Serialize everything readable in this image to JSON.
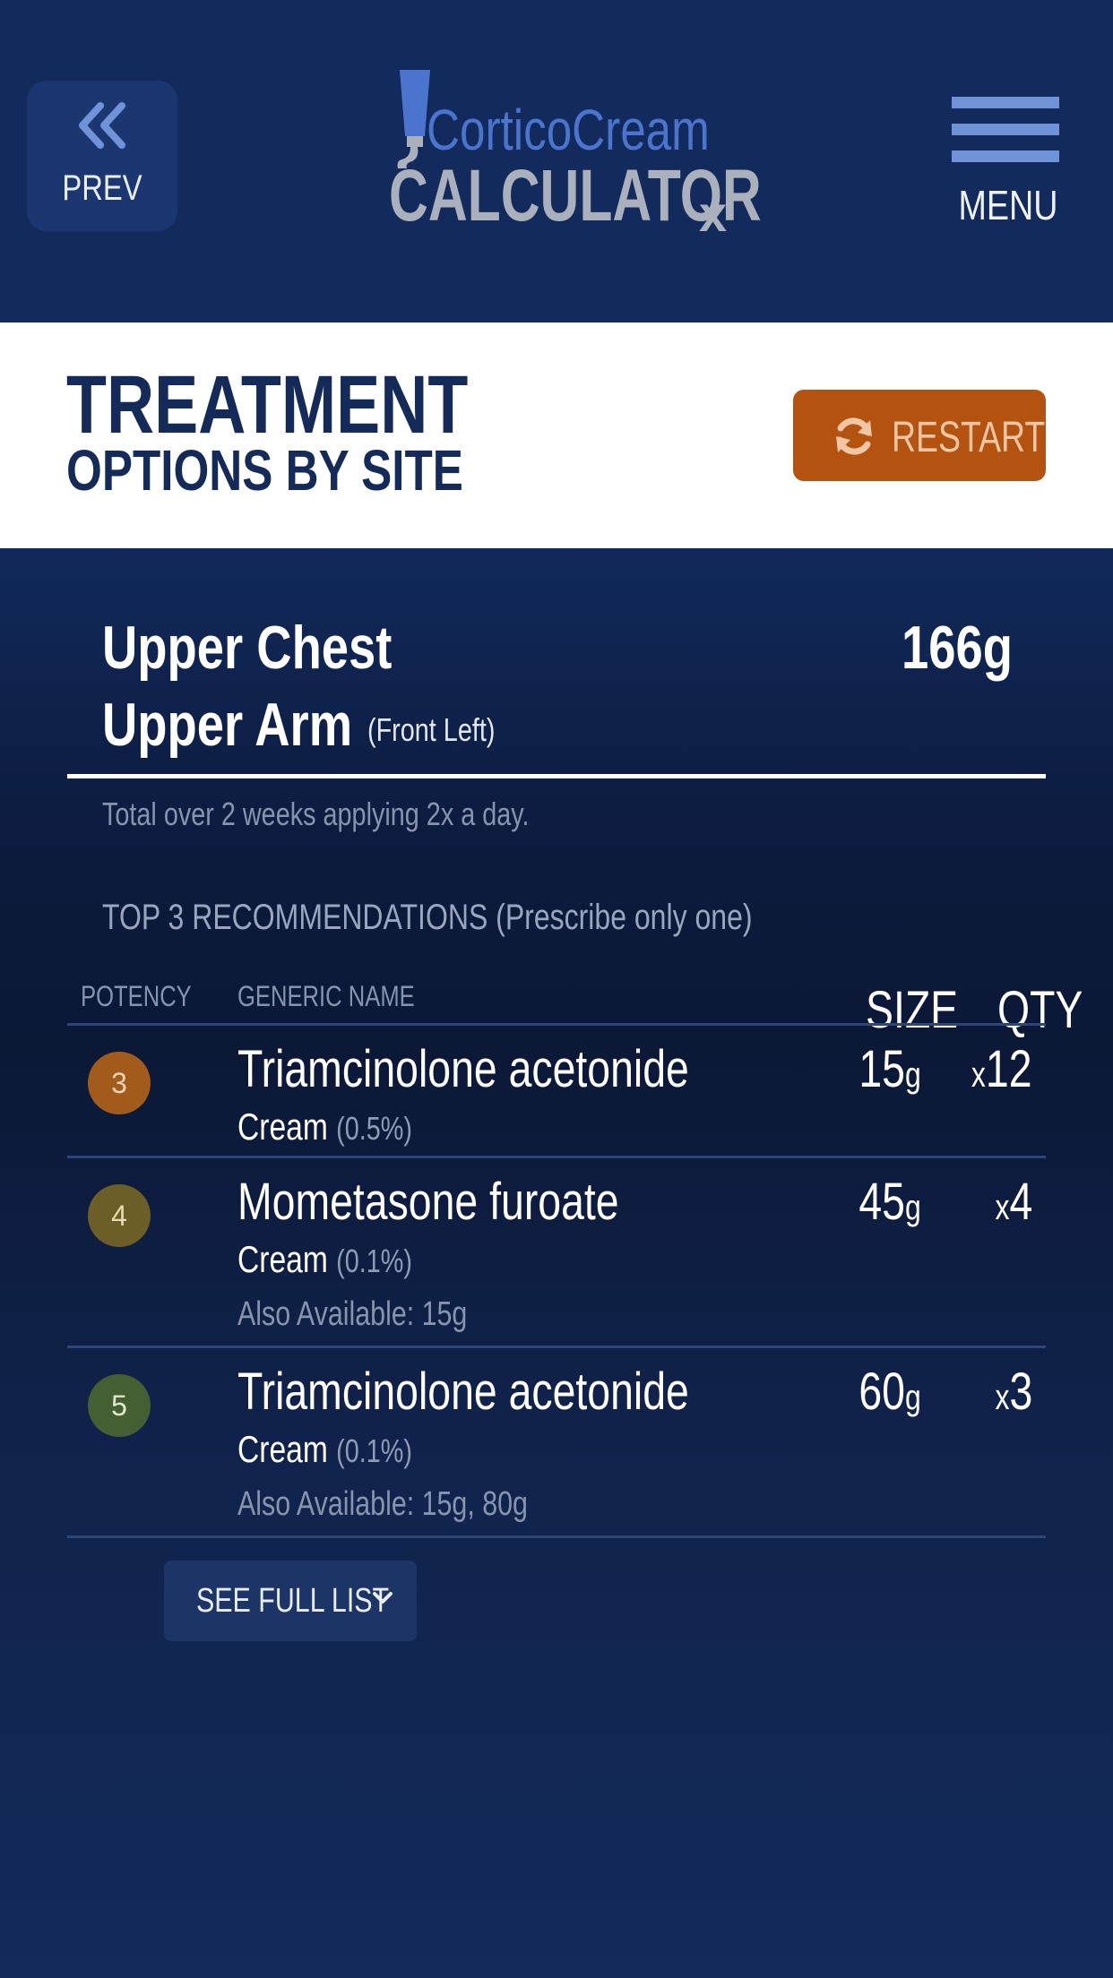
{
  "header": {
    "prev_label": "PREV",
    "logo_line1": "CorticoCream",
    "logo_line2": "CALCULATOR",
    "logo_rx": "x",
    "menu_label": "MENU"
  },
  "title": {
    "main": "TREATMENT",
    "sub": "OPTIONS BY SITE",
    "restart_label": "RESTART"
  },
  "summary": {
    "site_line1": "Upper Chest",
    "site_line2": "Upper Arm",
    "site_detail": "(Front Left)",
    "total_grams": "166g",
    "note": "Total over 2 weeks applying 2x a day."
  },
  "recommendations": {
    "title": "TOP 3 RECOMMENDATIONS (Prescribe only one)",
    "columns": {
      "potency": "POTENCY",
      "generic": "GENERIC NAME",
      "size": "SIZE",
      "qty": "QTY"
    },
    "rows": [
      {
        "potency": "3",
        "potency_color": "#a35b1c",
        "potency_text_color": "#f0d2b4",
        "name": "Triamcinolone acetonide",
        "form": "Cream",
        "concentration": "(0.5%)",
        "size": "15",
        "size_unit": "g",
        "qty_prefix": "x",
        "qty": "12",
        "also": ""
      },
      {
        "potency": "4",
        "potency_color": "#6b5e26",
        "potency_text_color": "#e5dcae",
        "name": "Mometasone furoate",
        "form": "Cream",
        "concentration": "(0.1%)",
        "size": "45",
        "size_unit": "g",
        "qty_prefix": "x",
        "qty": "4",
        "also": "Also Available: 15g"
      },
      {
        "potency": "5",
        "potency_color": "#445f31",
        "potency_text_color": "#dde8cc",
        "name": "Triamcinolone acetonide",
        "form": "Cream",
        "concentration": "(0.1%)",
        "size": "60",
        "size_unit": "g",
        "qty_prefix": "x",
        "qty": "3",
        "also": "Also Available: 15g, 80g"
      }
    ],
    "full_list_label": "SEE FULL LIST"
  },
  "colors": {
    "header_bg": "#122a5c",
    "accent": "#b4520f",
    "title_text": "#142a58",
    "icon_blue": "#6f93d6"
  },
  "icons": {
    "prev": "double-chevron-left-icon",
    "menu": "hamburger-icon",
    "restart": "refresh-icon",
    "full_list": "chevron-down-icon",
    "logo": "cream-tube-icon"
  }
}
